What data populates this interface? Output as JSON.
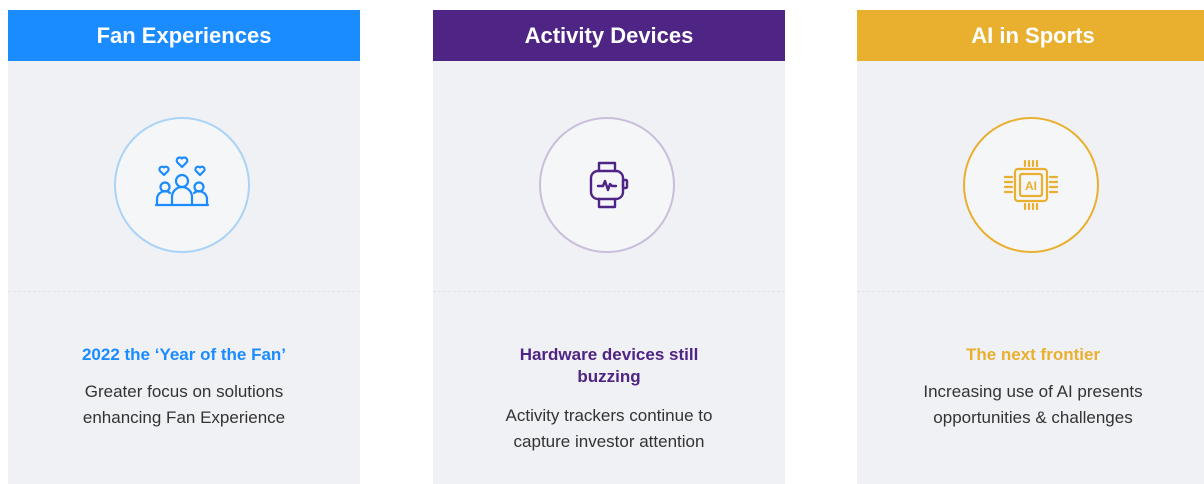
{
  "colors": {
    "fan": "#1a8cff",
    "activity": "#4e2484",
    "ai": "#e9b030",
    "card_bg": "#f0f1f4",
    "body_text": "#333333"
  },
  "cards": [
    {
      "header": "Fan Experiences",
      "icon": "fans-hearts-icon",
      "headline": "2022 the ‘Year of the Fan’",
      "description_line1": "Greater focus on solutions",
      "description_line2": "enhancing Fan Experience"
    },
    {
      "header": "Activity Devices",
      "icon": "smartwatch-icon",
      "headline_line1": "Hardware devices still",
      "headline_line2": "buzzing",
      "description_line1": "Activity trackers continue to",
      "description_line2": "capture investor attention"
    },
    {
      "header": "AI in Sports",
      "icon": "ai-chip-icon",
      "icon_label": "AI",
      "headline": "The next frontier",
      "description_line1": "Increasing use of AI presents",
      "description_line2": "opportunities & challenges"
    }
  ]
}
